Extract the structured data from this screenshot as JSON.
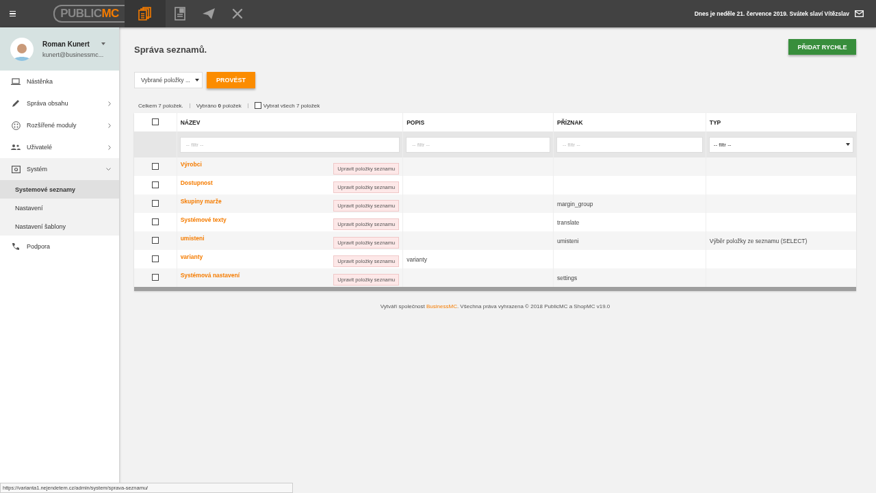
{
  "header": {
    "logo": {
      "text_1": "PUBLIC",
      "text_2": "MC"
    },
    "apps": [
      {
        "kind": "documents",
        "selected": true
      },
      {
        "kind": "form",
        "selected": false
      },
      {
        "kind": "plane",
        "selected": false
      },
      {
        "kind": "tools",
        "selected": false
      }
    ],
    "date_text": "Dnes je neděle 21. července 2019. Svátek slaví Vítězslav"
  },
  "sidebar": {
    "user": {
      "name": "Roman Kunert",
      "email": "kunert@businessmc..."
    },
    "items": [
      {
        "kind": "laptop",
        "label": "Nástěnka"
      },
      {
        "kind": "pencil",
        "label": "Správa obsahu",
        "expanded": false
      },
      {
        "kind": "modules",
        "label": "Rozšířené moduly",
        "expanded": false
      },
      {
        "kind": "users",
        "label": "Uživatelé",
        "expanded": false
      },
      {
        "kind": "system",
        "label": "Systém",
        "expanded": true,
        "children": [
          {
            "label": "Systemové seznamy",
            "selected": true
          },
          {
            "label": "Nastavení",
            "selected": false
          },
          {
            "label": "Nastavení šablony",
            "selected": false
          }
        ]
      },
      {
        "kind": "phone",
        "label": "Podpora"
      }
    ]
  },
  "page": {
    "title": "Správa seznamů.",
    "quick_add_button": "PŘIDAT RYCHLE",
    "bulk_select": "Vybrané položky ...",
    "run_button": "PROVÉST",
    "summary": {
      "total": "Celkem 7 položek.",
      "selected": "Vybráno **0** položek",
      "select_all": "Vybrat všech 7 položek",
      "select_all_checked": false
    }
  },
  "table": {
    "columns": [
      "NÁZEV",
      "POPIS",
      "PŘÍZNAK",
      "TYP"
    ],
    "filters": [
      {
        "kind": "text",
        "placeholder": "-- filtr --"
      },
      {
        "kind": "text",
        "placeholder": "-- filtr --"
      },
      {
        "kind": "text",
        "placeholder": "-- filtr --"
      },
      {
        "kind": "select",
        "value": "-- filtr --"
      }
    ],
    "header_checked": false,
    "rows": [
      {
        "checked": false,
        "name": "Výrobci",
        "action": "Upravit položky seznamu",
        "popis": "",
        "priznak": "",
        "typ": ""
      },
      {
        "checked": false,
        "name": "Dostupnost",
        "action": "Upravit položky seznamu",
        "popis": "",
        "priznak": "",
        "typ": ""
      },
      {
        "checked": false,
        "name": "Skupiny marže",
        "action": "Upravit položky seznamu",
        "popis": "",
        "priznak": "margin_group",
        "typ": ""
      },
      {
        "checked": false,
        "name": "Systémové texty",
        "action": "Upravit položky seznamu",
        "popis": "",
        "priznak": "translate",
        "typ": ""
      },
      {
        "checked": false,
        "name": "umisteni",
        "action": "Upravit položky seznamu",
        "popis": "",
        "priznak": "umisteni",
        "typ": "Výběr položky ze seznamu (SELECT)"
      },
      {
        "checked": false,
        "name": "varianty",
        "action": "Upravit položky seznamu",
        "popis": "varianty",
        "priznak": "",
        "typ": ""
      },
      {
        "checked": false,
        "name": "Systémová nastavení",
        "action": "Upravit položky seznamu",
        "popis": "",
        "priznak": "settings",
        "typ": ""
      }
    ]
  },
  "footer": {
    "text_before": "Vytváří společnost",
    "link": "BusinessMC",
    "text_after": ". Všechna práva vyhrazena © 2018 PublicMC a ShopMC v19.0"
  },
  "status_url": "https://varianta1.nejendetem.cz/admin/system/sprava-seznamu/"
}
